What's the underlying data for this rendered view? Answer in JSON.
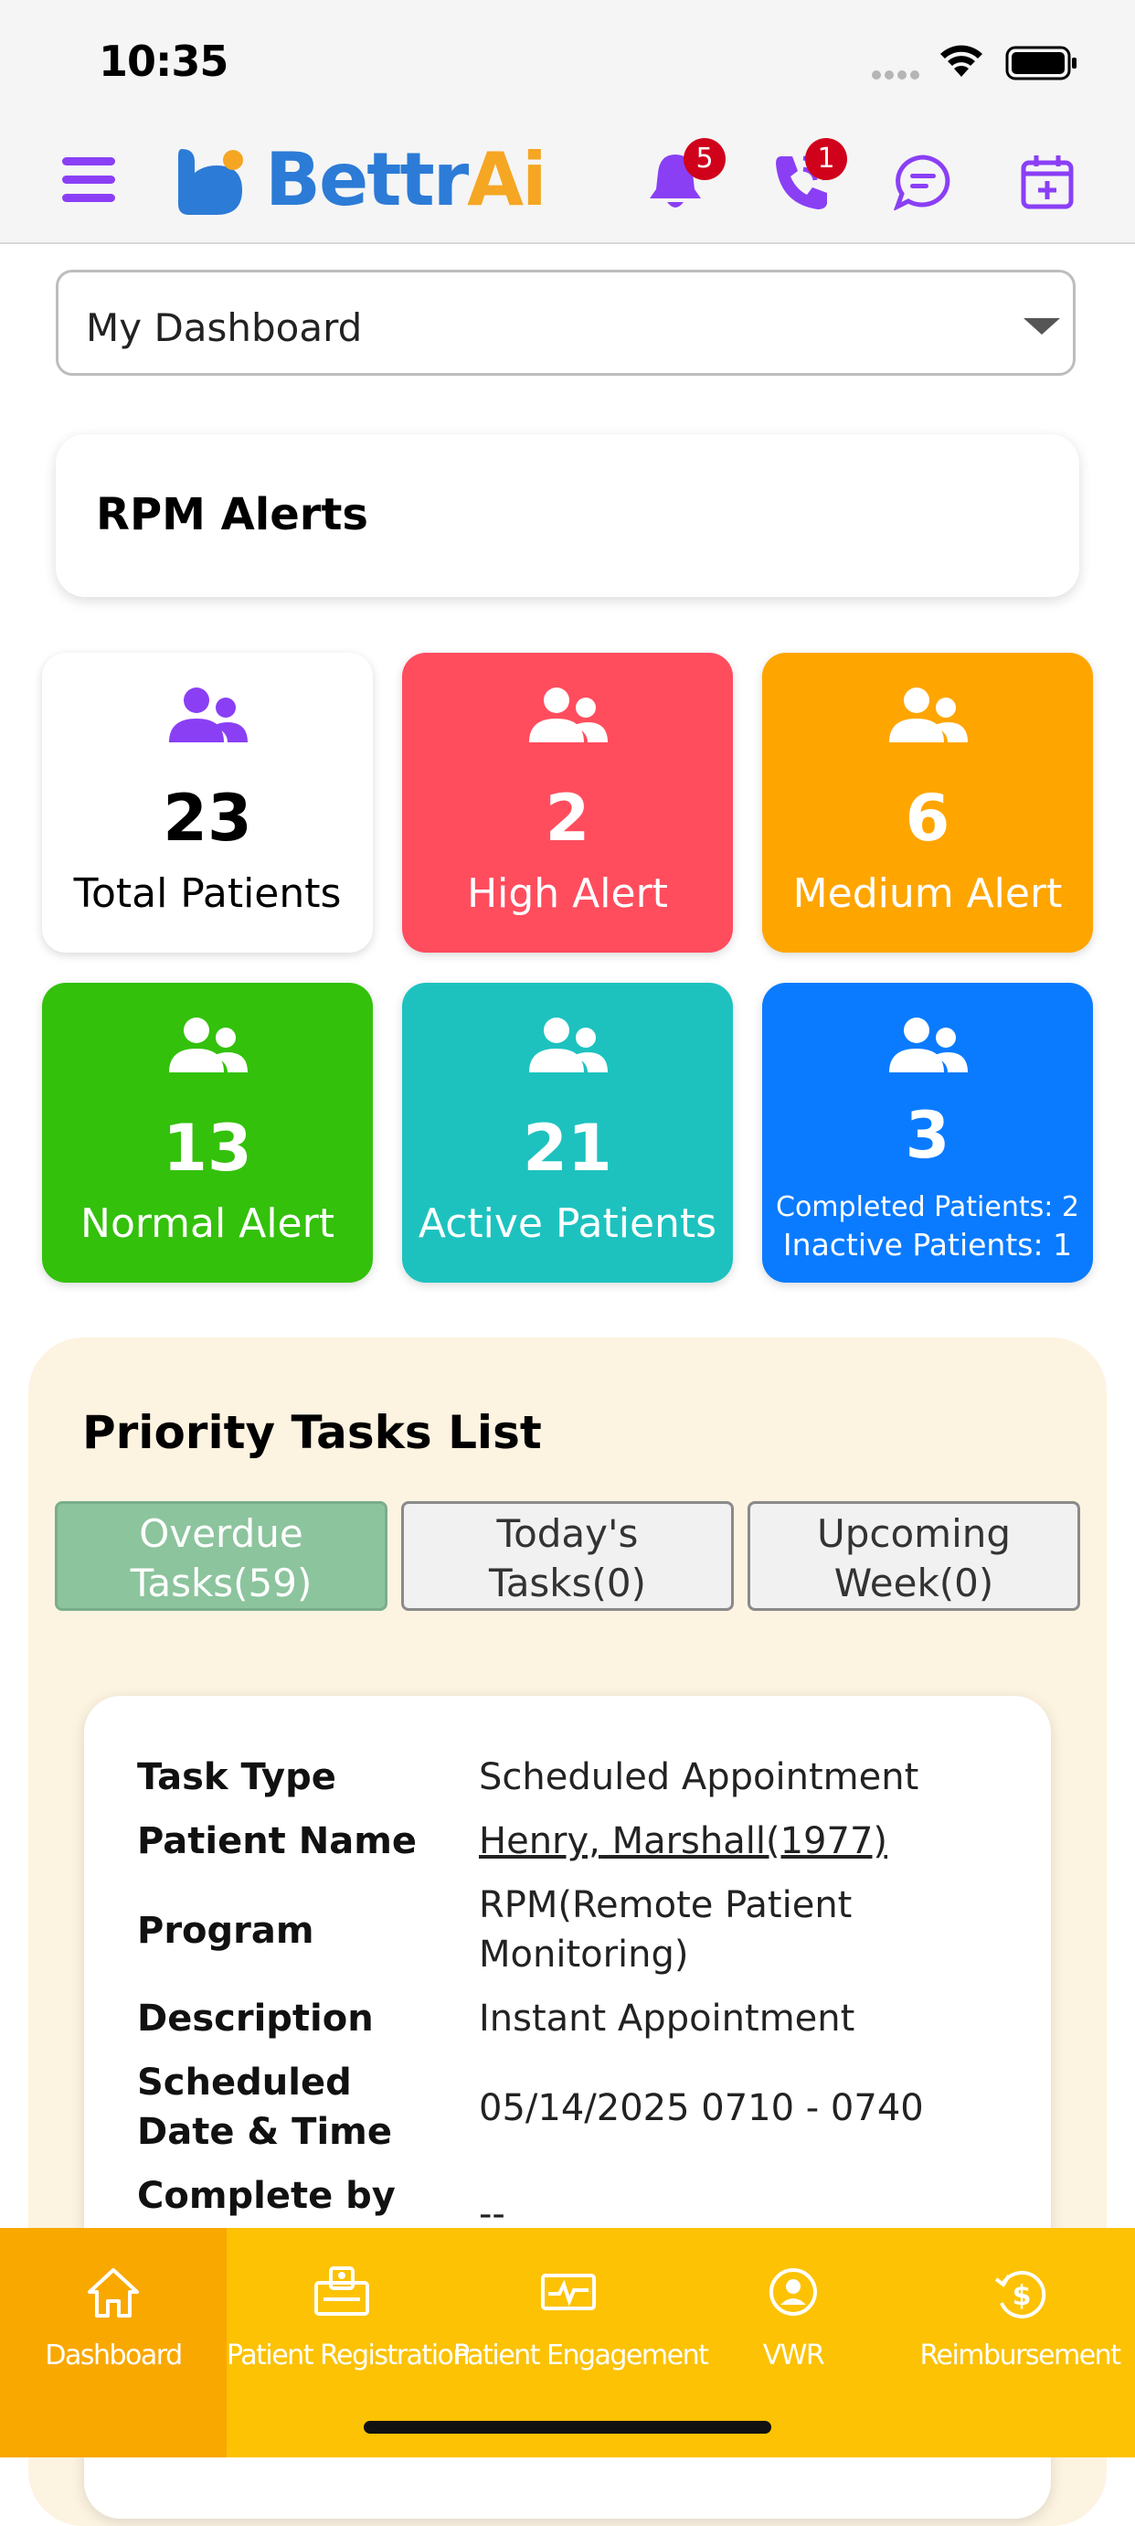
{
  "status_bar": {
    "time": "10:35"
  },
  "header": {
    "brand_prefix": "Bettr",
    "brand_suffix": "Ai",
    "notifications_count": "5",
    "calls_count": "1"
  },
  "dashboard_select": {
    "value": "My Dashboard"
  },
  "rpm": {
    "title": "RPM Alerts",
    "tiles": [
      {
        "value": "23",
        "label": "Total Patients",
        "color": "#ffffff"
      },
      {
        "value": "2",
        "label": "High Alert",
        "color": "#ff4d5e"
      },
      {
        "value": "6",
        "label": "Medium Alert",
        "color": "#ffa500"
      },
      {
        "value": "13",
        "label": "Normal Alert",
        "color": "#33c10b"
      },
      {
        "value": "21",
        "label": "Active Patients",
        "color": "#1dc2bf"
      },
      {
        "value": "3",
        "sub1": "Completed Patients: 2",
        "sub2": "Inactive Patients: 1",
        "color": "#0a7bff"
      }
    ]
  },
  "tasks": {
    "title": "Priority Tasks List",
    "tabs": [
      {
        "line1": "Overdue",
        "line2": "Tasks(59)"
      },
      {
        "line1": "Today's",
        "line2": "Tasks(0)"
      },
      {
        "line1": "Upcoming",
        "line2": "Week(0)"
      }
    ],
    "card": {
      "task_type_label": "Task Type",
      "task_type_value": "Scheduled Appointment",
      "patient_name_label": "Patient Name",
      "patient_name_value": "Henry, Marshall(1977)",
      "program_label": "Program",
      "program_value": "RPM(Remote Patient Monitoring)",
      "description_label": "Description",
      "description_value": "Instant Appointment",
      "scheduled_label": "Scheduled Date & Time",
      "scheduled_value": "05/14/2025 0710 - 0740",
      "complete_by_label": "Complete by Date",
      "complete_by_value": "--"
    }
  },
  "bottom_nav": [
    {
      "label": "Dashboard"
    },
    {
      "label": "Patient Registration"
    },
    {
      "label": "Patient Engagement"
    },
    {
      "label": "VWR"
    },
    {
      "label": "Reimbursement"
    }
  ],
  "colors": {
    "accent_purple": "#8a3ff5",
    "brand_blue": "#2c7bd6",
    "brand_orange": "#f5a623",
    "nav_yellow": "#fcc203",
    "nav_active": "#f9a800",
    "tab_active": "#8cc49d"
  }
}
